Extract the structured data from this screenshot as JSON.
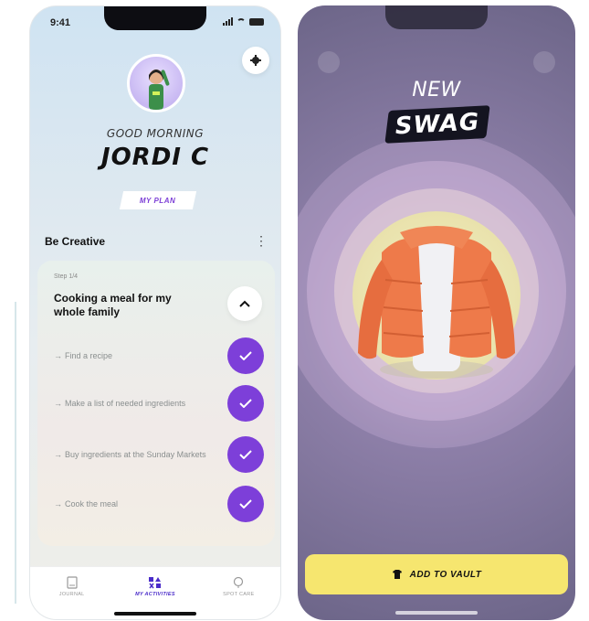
{
  "left_screen": {
    "status_bar": {
      "time": "9:41"
    },
    "greeting": "GOOD MORNING",
    "username": "JORDI C",
    "plan_button": "MY PLAN",
    "section_title": "Be Creative",
    "task": {
      "subtitle": "Step 1/4",
      "title": "Cooking a meal for my whole family",
      "steps": [
        "Find a recipe",
        "Make a list of needed ingredients",
        "Buy ingredients at the Sunday Markets",
        "Cook the meal"
      ]
    },
    "tabs": [
      {
        "label": "JOURNAL",
        "icon": "journal-icon",
        "active": false
      },
      {
        "label": "MY ACTIVITIES",
        "icon": "activities-icon",
        "active": true
      },
      {
        "label": "SPOT CARE",
        "icon": "spot-care-icon",
        "active": false
      }
    ]
  },
  "right_screen": {
    "headline_top": "NEW",
    "headline_main": "SWAG",
    "cta": {
      "label": "ADD TO VAULT",
      "icon": "shirt-icon"
    }
  },
  "colors": {
    "accent_purple": "#7d3fd9",
    "cta_yellow": "#f6e66f",
    "swag_bg": "#8d7fa8"
  }
}
